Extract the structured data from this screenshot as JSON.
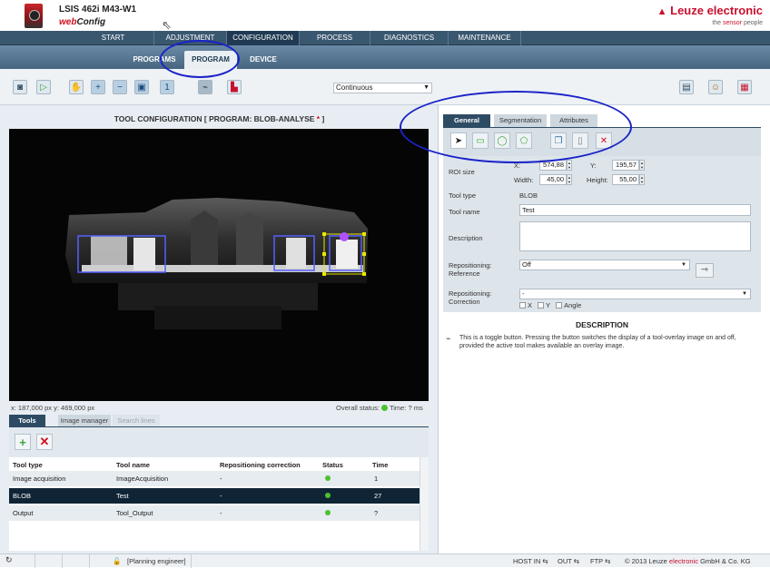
{
  "header": {
    "device_name": "LSIS 462i M43-W1",
    "app_name_prefix": "web",
    "app_name_suffix": "Config",
    "brand": "Leuze electronic",
    "tagline_prefix": "the ",
    "tagline_highlight": "sensor",
    "tagline_suffix": " people"
  },
  "main_nav": {
    "tabs": [
      "START",
      "ADJUSTMENT",
      "CONFIGURATION",
      "PROCESS",
      "DIAGNOSTICS",
      "MAINTENANCE"
    ],
    "active": "CONFIGURATION"
  },
  "sub_nav": {
    "tabs": [
      "PROGRAMS",
      "PROGRAM",
      "DEVICE"
    ],
    "active": "PROGRAM"
  },
  "toolbar": {
    "trigger_mode": "Continuous"
  },
  "tool_config": {
    "title_prefix": "TOOL CONFIGURATION   [ PROGRAM: BLOB-ANALYSE",
    "title_star": " *",
    "title_suffix": " ]"
  },
  "image_status": {
    "coordinates": "x: 187,000 px y: 469,000 px",
    "overall_status_label": "Overall status:",
    "time_label": "Time: ? ms"
  },
  "bottom_tabs": {
    "tools": "Tools",
    "image_manager": "Image manager",
    "search_lines": "Search lines"
  },
  "tools_table": {
    "headers": [
      "Tool type",
      "Tool name",
      "Repositioning correction",
      "Status",
      "Time"
    ],
    "rows": [
      {
        "type": "Image acquisition",
        "name": "ImageAcquisition",
        "repos": "-",
        "time": "1"
      },
      {
        "type": "BLOB",
        "name": "Test",
        "repos": "-",
        "time": "27"
      },
      {
        "type": "Output",
        "name": "Tool_Output",
        "repos": "-",
        "time": "?"
      }
    ],
    "selected_index": 1
  },
  "right_tabs": {
    "general": "General",
    "segmentation": "Segmentation",
    "attributes": "Attributes"
  },
  "properties": {
    "roi_size_label": "ROI size",
    "x_label": "X:",
    "x_value": "574,88",
    "y_label": "Y:",
    "y_value": "195,57",
    "width_label": "Width:",
    "width_value": "45,00",
    "height_label": "Height:",
    "height_value": "55,00",
    "tool_type_label": "Tool type",
    "tool_type_value": "BLOB",
    "tool_name_label": "Tool name",
    "tool_name_value": "Test",
    "description_label": "Description",
    "repos_ref_label_1": "Repositioning:",
    "repos_ref_label_2": "Reference",
    "repos_ref_value": "Off",
    "repos_corr_label_1": "Repositioning:",
    "repos_corr_label_2": "Correction",
    "repos_corr_value": "-",
    "chk_x": "X",
    "chk_y": "Y",
    "chk_angle": "Angle"
  },
  "description": {
    "title": "DESCRIPTION",
    "text": "This is a toggle button. Pressing the button switches the display of a tool-overlay image on and off, provided the active tool makes available an overlay image."
  },
  "statusbar": {
    "user": "[Planning engineer]",
    "host_in": "HOST IN",
    "out": "OUT",
    "ftp": "FTP",
    "copyright_prefix": "© 2013 Leuze ",
    "copyright_highlight": "electronic",
    "copyright_suffix": " GmbH & Co. KG"
  },
  "colors": {
    "nav_dark": "#3a5770",
    "brand_red": "#c8102e",
    "status_green": "#4cc22e",
    "annotation_blue": "#1a23c8",
    "roi_purple": "#b050ff"
  }
}
